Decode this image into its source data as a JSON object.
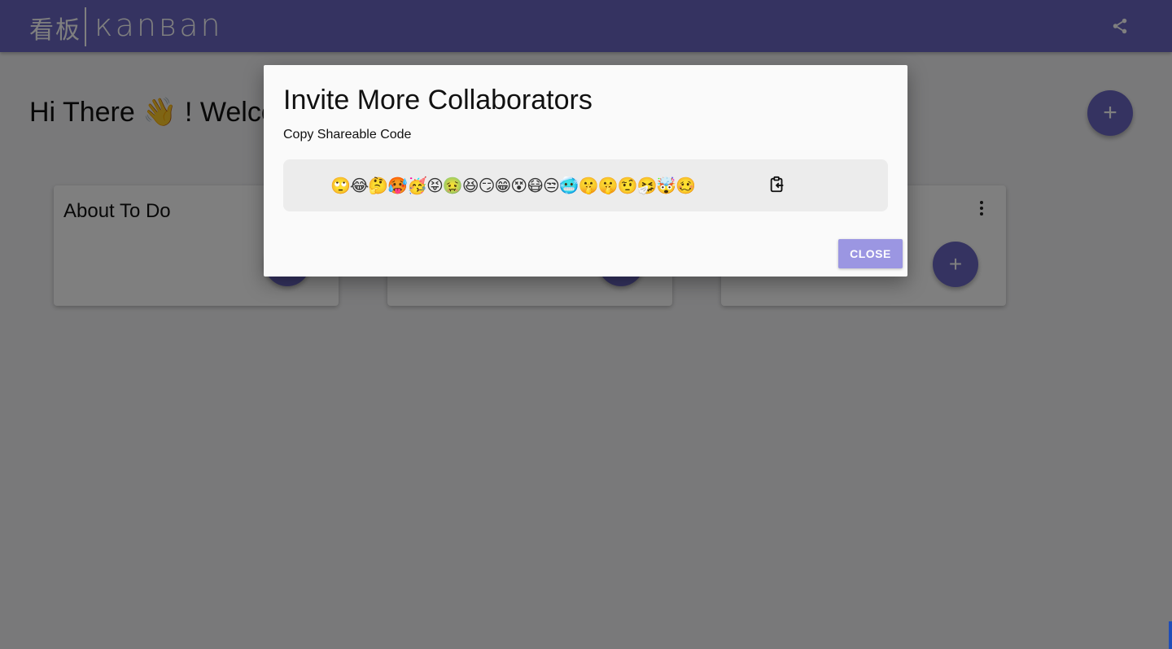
{
  "app": {
    "logo_cn": "看板",
    "logo_en": "кanвan",
    "share_icon": "share-icon",
    "brand_color": "#6b66c2"
  },
  "greeting": "Hi There 👋 ! Welcome",
  "add_board_label": "+",
  "columns": [
    {
      "title": "About To Do",
      "add_label": "+"
    },
    {
      "title": "",
      "add_label": "+"
    },
    {
      "title": "",
      "add_label": "+",
      "menu_icon": "more-vert-icon"
    }
  ],
  "dialog": {
    "title": "Invite More Collaborators",
    "subtitle": "Copy Shareable Code",
    "code": "🙄😂🤔🥵🥳😝🤢😆😏😁😵😷😒🥶🤫🤫🤨🤧🤯🥴",
    "copy_icon": "clipboard-copy-icon",
    "close_label": "CLOSE",
    "close_color": "#9b96e2"
  }
}
